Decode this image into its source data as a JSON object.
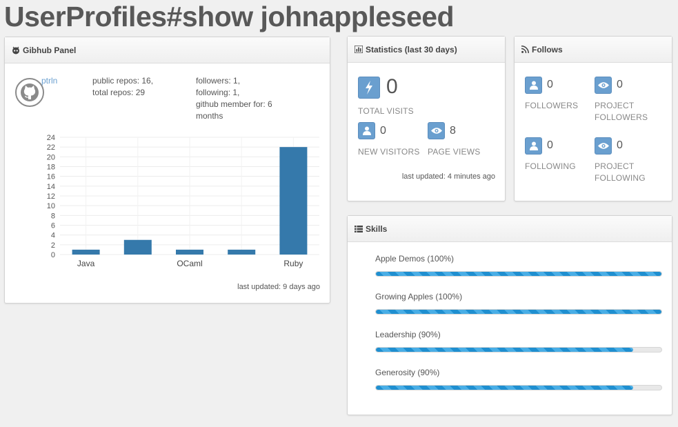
{
  "page": {
    "title": "UserProfiles#show johnappleseed"
  },
  "github_panel": {
    "title": "Gibhub Panel",
    "username": "ptrln",
    "public_repos": "public repos: 16,",
    "total_repos": "total repos: 29",
    "followers": "followers: 1,",
    "following": "following: 1,",
    "member_for": "github member for: 6",
    "member_for_unit": "months",
    "updated": "last updated: 9 days ago"
  },
  "chart_data": {
    "type": "bar",
    "categories": [
      "Java",
      "",
      "OCaml",
      "",
      "Ruby"
    ],
    "values": [
      1,
      3,
      1,
      1,
      22
    ],
    "y_ticks": [
      "0",
      "2",
      "4",
      "6",
      "8",
      "10",
      "12",
      "14",
      "16",
      "18",
      "20",
      "22",
      "24"
    ],
    "ylim": [
      0,
      24
    ],
    "color": "#3579ab"
  },
  "statistics": {
    "title": "Statistics (last 30 days)",
    "total_visits": {
      "value": "0",
      "label": "TOTAL VISITS"
    },
    "new_visitors": {
      "value": "0",
      "label": "NEW VISITORS"
    },
    "page_views": {
      "value": "8",
      "label": "PAGE VIEWS"
    },
    "updated": "last updated: 4 minutes ago"
  },
  "follows": {
    "title": "Follows",
    "followers": {
      "value": "0",
      "label": "FOLLOWERS"
    },
    "project_followers": {
      "value": "0",
      "label1": "PROJECT",
      "label2": "FOLLOWERS"
    },
    "following": {
      "value": "0",
      "label": "FOLLOWING"
    },
    "project_following": {
      "value": "0",
      "label1": "PROJECT",
      "label2": "FOLLOWING"
    }
  },
  "skills": {
    "title": "Skills",
    "items": [
      {
        "label": "Apple Demos (100%)",
        "percent": 100
      },
      {
        "label": "Growing Apples (100%)",
        "percent": 100
      },
      {
        "label": "Leadership (90%)",
        "percent": 90
      },
      {
        "label": "Generosity (90%)",
        "percent": 90
      }
    ]
  },
  "colors": {
    "accent": "#6a9fcf",
    "bar": "#3579ab",
    "skill": "#1f8fd0"
  }
}
